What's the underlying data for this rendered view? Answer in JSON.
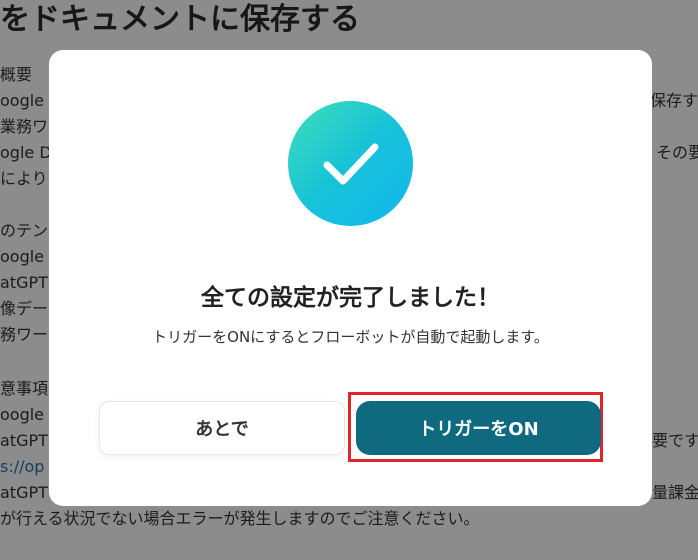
{
  "background": {
    "title": "をドキュメントに保存する",
    "lines": [
      "概要",
      "oogle I",
      "業務ワ",
      "ogle D",
      "により",
      "のテン",
      "oogle I",
      "atGPT",
      "像デー",
      "務ワー",
      "意事項",
      "oogle I",
      "atGPT",
      "s://op",
      "atGPT",
      "が行える状況でない場合エラーが発生しますのでご注意ください。"
    ],
    "right_lines": [
      "保存す",
      "その要",
      "要です",
      "量課金"
    ]
  },
  "modal": {
    "title": "全ての設定が完了しました！",
    "description": "トリガーをONにするとフローボットが自動で起動します。",
    "later_button": "あとで",
    "on_button": "トリガーをON",
    "icon": "check-icon",
    "colors": {
      "button_primary": "#0f6a80",
      "highlight": "#e0262d",
      "check_gradient_start": "#3ee0b8",
      "check_gradient_end": "#12b6ef"
    }
  }
}
